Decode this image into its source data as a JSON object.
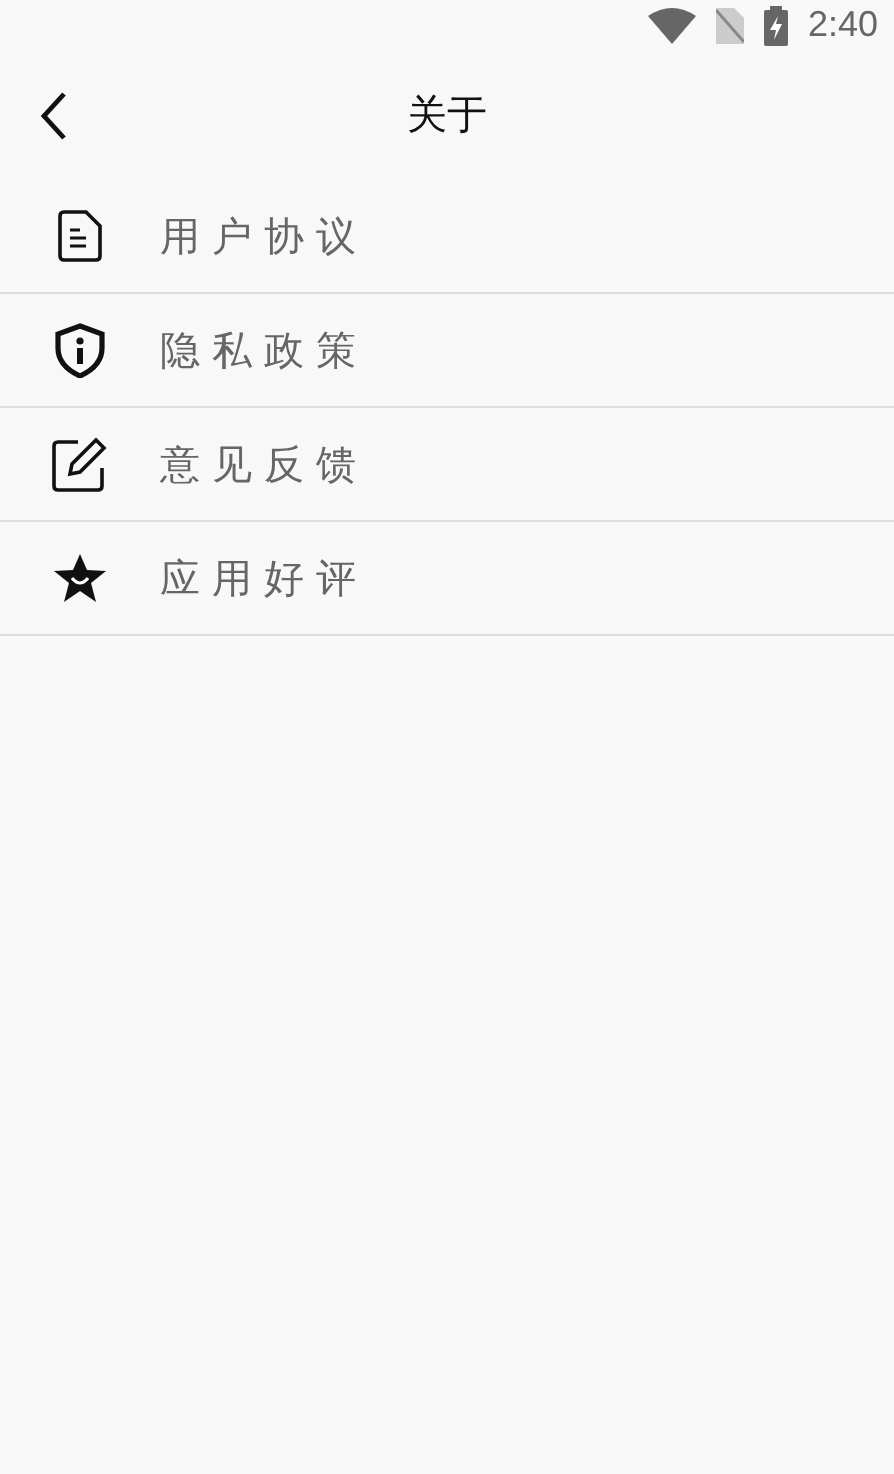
{
  "status_bar": {
    "time": "2:40"
  },
  "app_bar": {
    "title": "关于"
  },
  "menu": [
    {
      "kind": "document",
      "label": "用户协议"
    },
    {
      "kind": "shield",
      "label": "隐私政策"
    },
    {
      "kind": "edit",
      "label": "意见反馈"
    },
    {
      "kind": "star",
      "label": "应用好评"
    }
  ]
}
